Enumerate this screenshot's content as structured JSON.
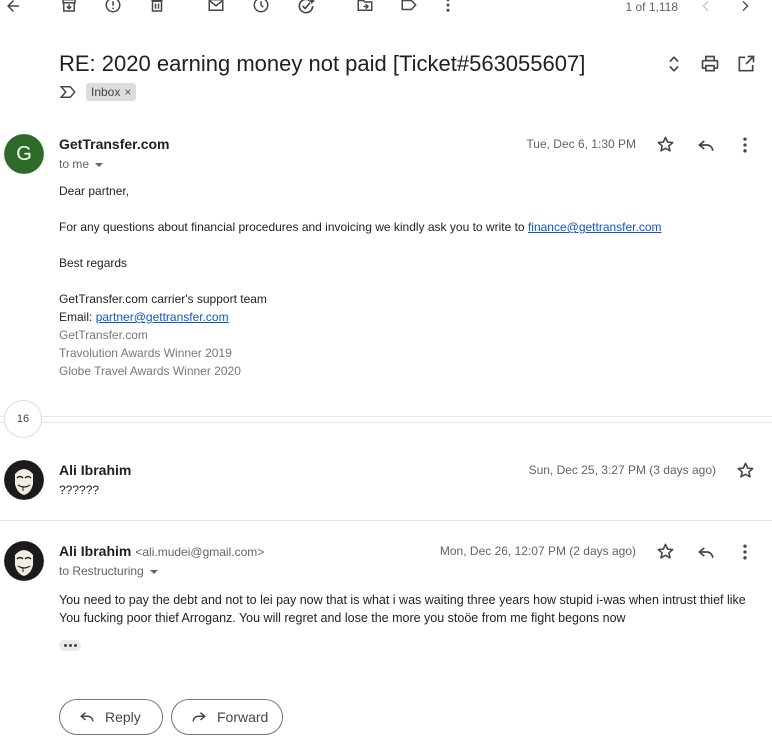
{
  "toolbar": {
    "icons": [
      "back-arrow-icon",
      "archive-icon",
      "report-spam-icon",
      "delete-icon",
      "mark-unread-icon",
      "snooze-icon",
      "add-task-icon",
      "move-to-icon",
      "label-icon",
      "more-vert-icon",
      "newer-icon",
      "older-icon"
    ],
    "count_text": "1 of 1,118"
  },
  "thread": {
    "subject": "RE: 2020 earning money not paid [Ticket#563055607]",
    "label": "Inbox",
    "label_remove": "×"
  },
  "message1": {
    "avatar_letter": "G",
    "avatar_color": "#2e6b2a",
    "sender": "GetTransfer.com",
    "to": "to me",
    "time": "Tue, Dec 6, 1:30 PM",
    "greeting": "Dear partner,",
    "line1_prefix": "For any questions about financial procedures and invoicing we kindly ask you to write to ",
    "line1_link": "finance@gettransfer.com",
    "closing": "Best regards",
    "sig_team": "GetTransfer.com carrier's support team",
    "sig_email_label": "Email: ",
    "sig_email_link": "partner@gettransfer.com",
    "sig_site": "GetTransfer.com",
    "sig_award1": "Travolution Awards Winner 2019",
    "sig_award2": "Globe Travel Awards Winner 2020"
  },
  "collapsed": {
    "count": "16"
  },
  "message2": {
    "sender": "Ali Ibrahim",
    "time": "Sun, Dec 25, 3:27 PM (3 days ago)",
    "snippet": "??????"
  },
  "message3": {
    "sender": "Ali Ibrahim",
    "sender_email": "<ali.mudei@gmail.com>",
    "to": "to Restructuring",
    "time": "Mon, Dec 26, 12:07 PM (2 days ago)",
    "body": "You need to pay the debt and not to lei pay now that is what i was waiting three years how stupid i-was when intrust thief like You fucking poor thief Arroganz. You will regret and lose the more you stoöe from me fight begons now"
  },
  "actions": {
    "reply": "Reply",
    "forward": "Forward"
  },
  "colors": {
    "link": "#1155cc",
    "icon": "#444746"
  }
}
